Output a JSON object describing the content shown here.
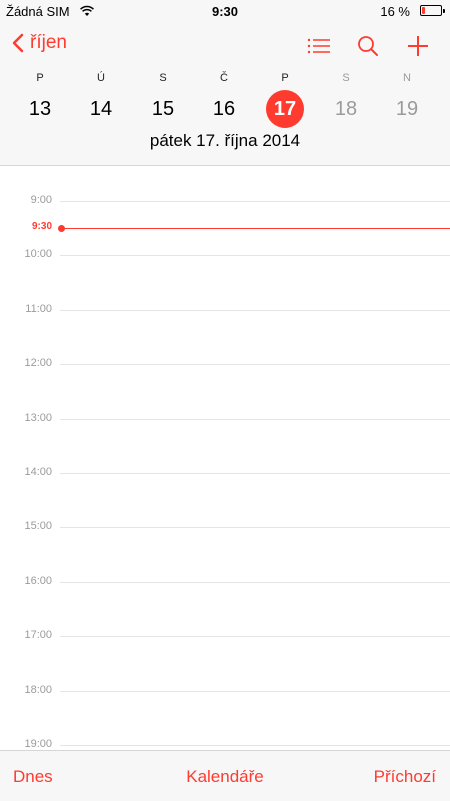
{
  "status_bar": {
    "carrier": "Žádná SIM",
    "time": "9:30",
    "battery_text": "16 %",
    "battery_level": 0.16
  },
  "nav": {
    "back_label": "říjen",
    "accent_color": "#ff3b30"
  },
  "week": {
    "days": [
      {
        "letter": "P",
        "date": "13",
        "weekend": false,
        "selected": false
      },
      {
        "letter": "Ú",
        "date": "14",
        "weekend": false,
        "selected": false
      },
      {
        "letter": "S",
        "date": "15",
        "weekend": false,
        "selected": false
      },
      {
        "letter": "Č",
        "date": "16",
        "weekend": false,
        "selected": false
      },
      {
        "letter": "P",
        "date": "17",
        "weekend": false,
        "selected": true
      },
      {
        "letter": "S",
        "date": "18",
        "weekend": true,
        "selected": false
      },
      {
        "letter": "N",
        "date": "19",
        "weekend": true,
        "selected": false
      }
    ],
    "full_date": "pátek  17. října 2014"
  },
  "timeline": {
    "hours": [
      "9:00",
      "10:00",
      "11:00",
      "12:00",
      "13:00",
      "14:00",
      "15:00",
      "16:00",
      "17:00",
      "18:00",
      "19:00"
    ],
    "current_time": "9:30"
  },
  "tabbar": {
    "today": "Dnes",
    "calendars": "Kalendáře",
    "inbox": "Příchozí"
  }
}
